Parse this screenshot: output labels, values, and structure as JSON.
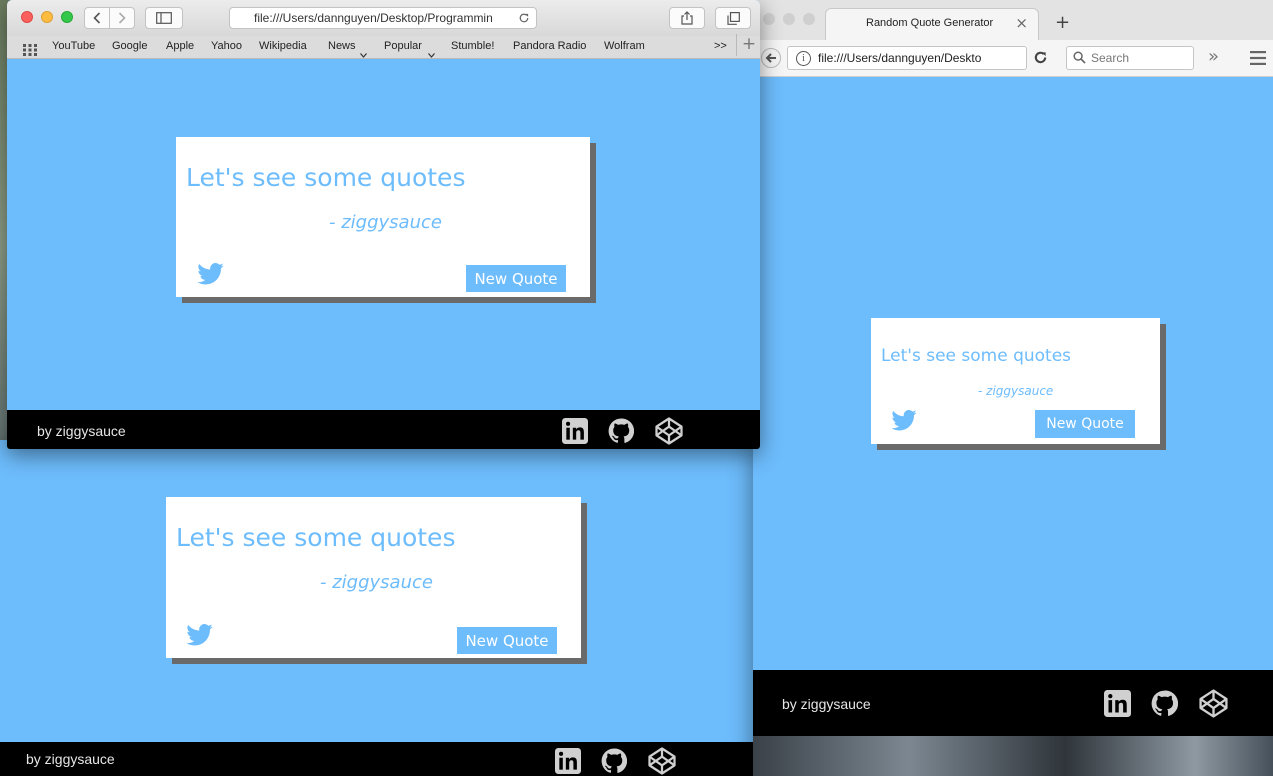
{
  "safari": {
    "url": "file:///Users/dannguyen/Desktop/Programmin",
    "bookmarks": [
      "YouTube",
      "Google",
      "Apple",
      "Yahoo",
      "Wikipedia",
      "News",
      "Popular",
      "Stumble!",
      "Pandora Radio",
      "Wolfram"
    ],
    "bookmarks_overflow": ">>",
    "new_tab": "+"
  },
  "firefox": {
    "tab_title": "Random Quote Generator",
    "tab_close": "×",
    "new_tab": "+",
    "url": "file:///Users/dannguyen/Deskto",
    "search_placeholder": "Search",
    "overflow": "»"
  },
  "quote": {
    "text": "Let's see some quotes",
    "author": "- ziggysauce",
    "button": "New Quote"
  },
  "footer": {
    "credit": "by ziggysauce"
  },
  "colors": {
    "accent": "#6dbcfc",
    "footer": "#000000",
    "card": "#ffffff"
  },
  "icons": [
    "twitter-icon",
    "linkedin-icon",
    "github-icon",
    "codepen-icon"
  ]
}
